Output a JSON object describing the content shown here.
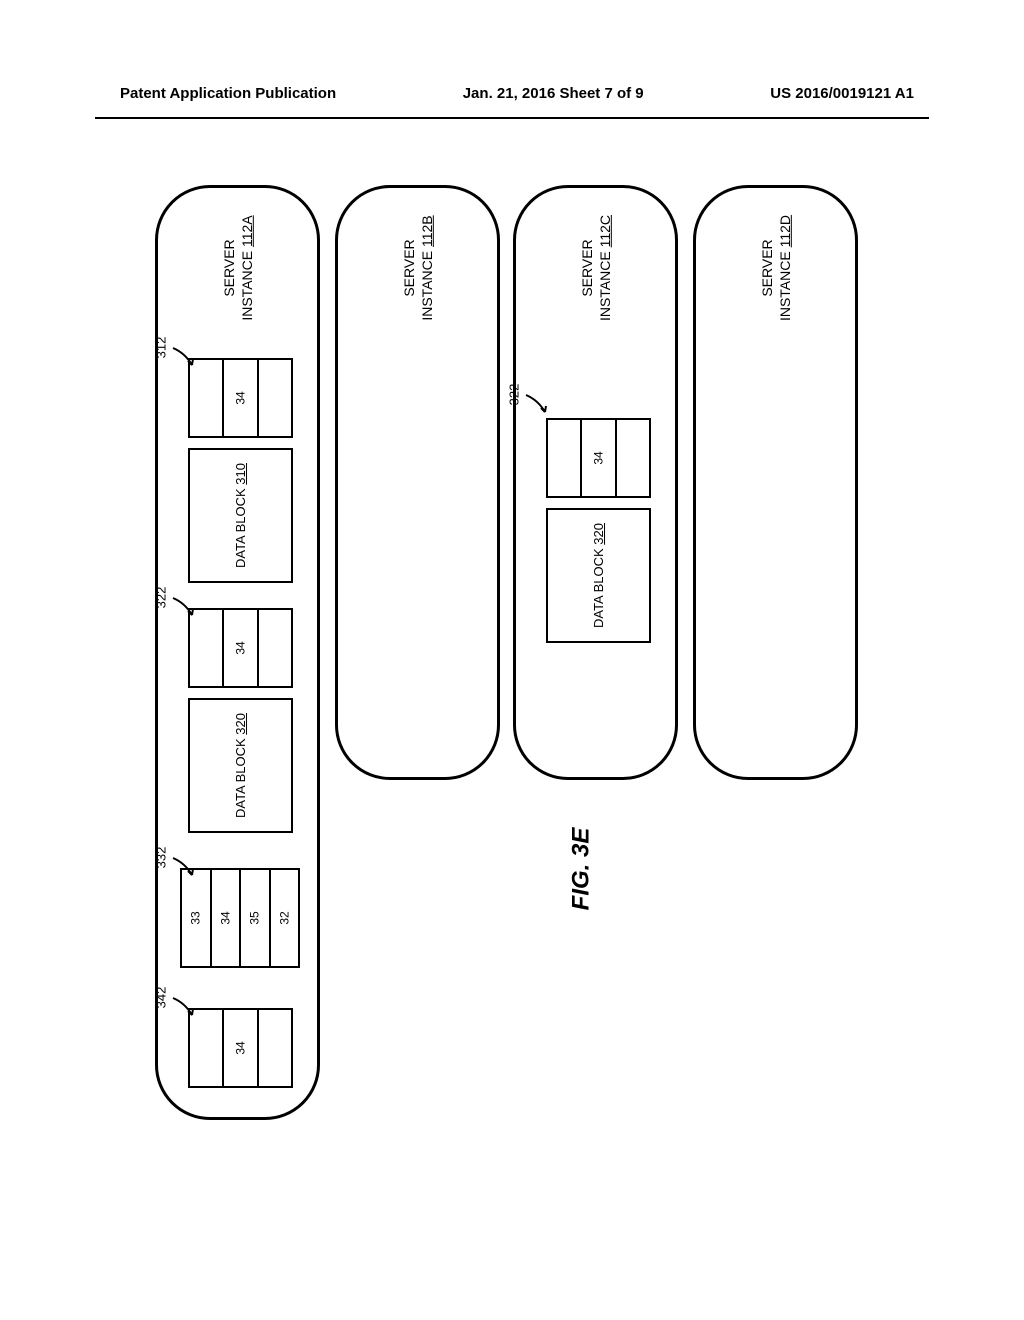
{
  "header": {
    "left": "Patent Application Publication",
    "center": "Jan. 21, 2016  Sheet 7 of 9",
    "right": "US 2016/0019121 A1"
  },
  "figure_label": "FIG. 3E",
  "servers": {
    "a": {
      "line1": "SERVER",
      "line2_prefix": "INSTANCE ",
      "line2_ref": "112A"
    },
    "b": {
      "line1": "SERVER",
      "line2_prefix": "INSTANCE ",
      "line2_ref": "112B"
    },
    "c": {
      "line1": "SERVER",
      "line2_prefix": "INSTANCE ",
      "line2_ref": "112C"
    },
    "d": {
      "line1": "SERVER",
      "line2_prefix": "INSTANCE ",
      "line2_ref": "112D"
    }
  },
  "data_blocks": {
    "b310": {
      "prefix": "DATA BLOCK ",
      "ref": "310"
    },
    "b320": {
      "prefix": "DATA BLOCK ",
      "ref": "320"
    }
  },
  "refs": {
    "r312": "312",
    "r322": "322",
    "r332": "332",
    "r342": "342"
  },
  "segments": {
    "s312": [
      "",
      "34",
      ""
    ],
    "s322": [
      "",
      "34",
      ""
    ],
    "s332": [
      "33",
      "34",
      "35",
      "32"
    ],
    "s342": [
      "",
      "34",
      ""
    ]
  }
}
